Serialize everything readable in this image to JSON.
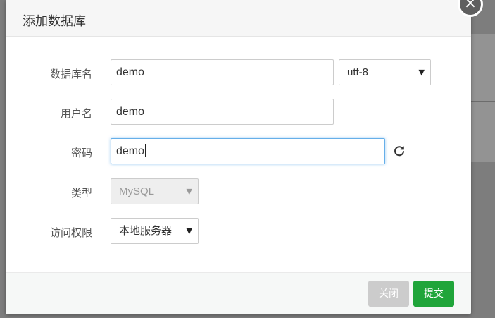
{
  "dialog": {
    "title": "添加数据库"
  },
  "form": {
    "db_name": {
      "label": "数据库名",
      "value": "demo"
    },
    "charset": {
      "value": "utf-8"
    },
    "username": {
      "label": "用户名",
      "value": "demo"
    },
    "password": {
      "label": "密码",
      "value": "demo"
    },
    "type": {
      "label": "类型",
      "value": "MySQL"
    },
    "access": {
      "label": "访问权限",
      "value": "本地服务器"
    }
  },
  "footer": {
    "close_label": "关闭",
    "submit_label": "提交"
  },
  "icons": {
    "close": "close-icon",
    "refresh": "refresh-icon",
    "dropdown": "triangle-down-icon"
  },
  "colors": {
    "submit": "#20a53a",
    "close_button": "#cccccc",
    "focus": "#66afe9"
  }
}
